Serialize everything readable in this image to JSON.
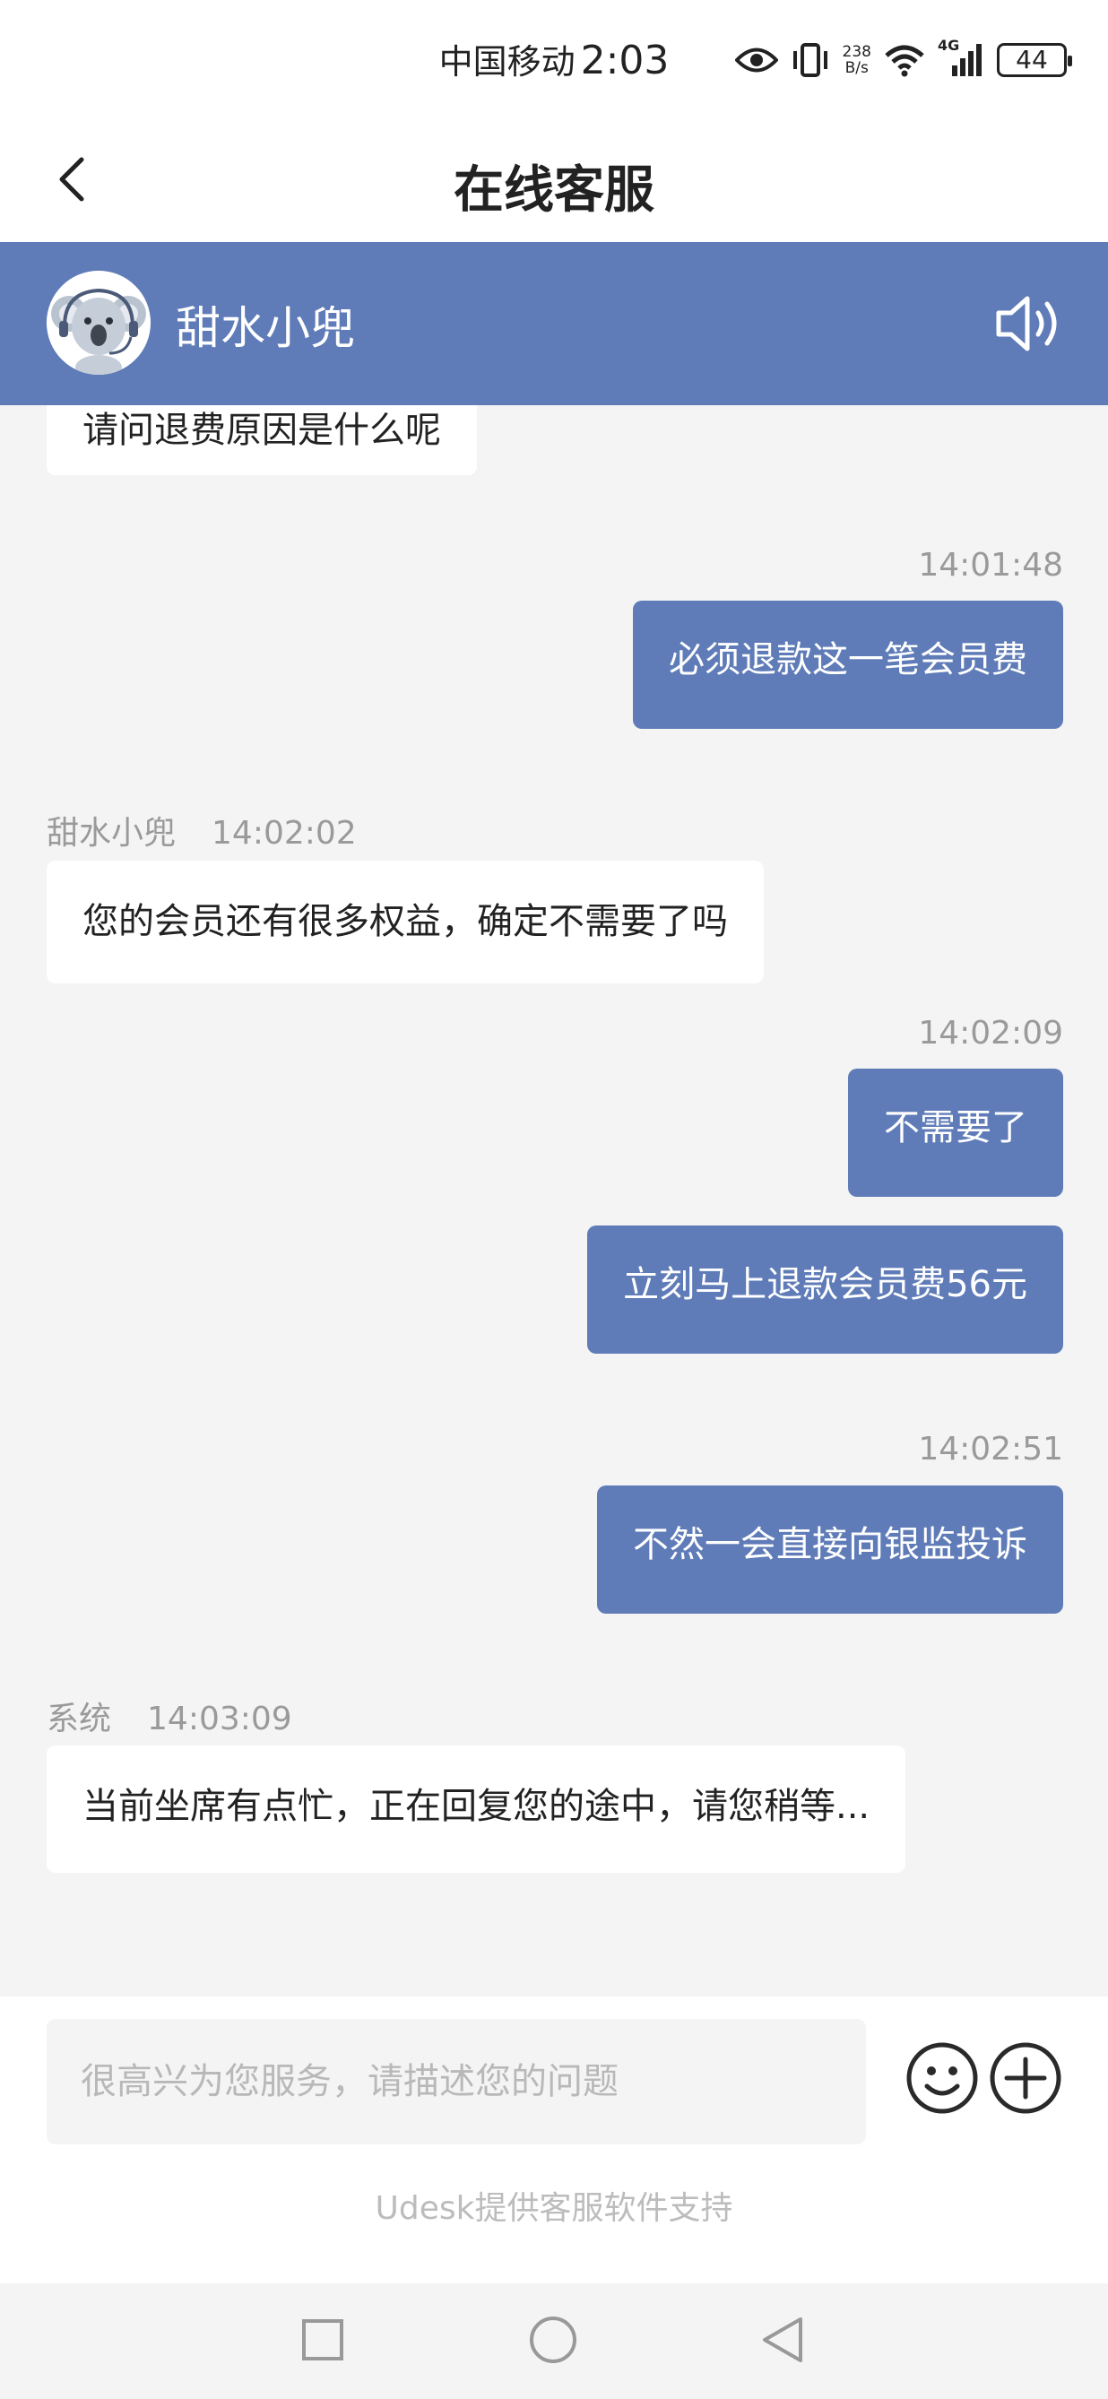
{
  "status_bar": {
    "carrier": "中国移动",
    "time": "2:03",
    "net_speed_value": "238",
    "net_speed_unit": "B/s",
    "network_type": "4G",
    "battery": "44"
  },
  "header": {
    "title": "在线客服"
  },
  "agent": {
    "name": "甜水小兜"
  },
  "messages": [
    {
      "side": "agent",
      "text": "请问退费原因是什么呢"
    },
    {
      "side": "user",
      "time": "14:01:48",
      "text": "必须退款这一笔会员费"
    },
    {
      "side": "agent",
      "sender": "甜水小兜",
      "time": "14:02:02",
      "text": "您的会员还有很多权益，确定不需要了吗"
    },
    {
      "side": "user",
      "time": "14:02:09",
      "text": "不需要了"
    },
    {
      "side": "user",
      "text": "立刻马上退款会员费56元"
    },
    {
      "side": "user",
      "time": "14:02:51",
      "text": "不然一会直接向银监投诉"
    },
    {
      "side": "system",
      "sender": "系统",
      "time": "14:03:09",
      "text": "当前坐席有点忙，正在回复您的途中，请您稍等..."
    }
  ],
  "input": {
    "placeholder": "很高兴为您服务，请描述您的问题",
    "value": ""
  },
  "footer": {
    "powered_by": "Udesk提供客服软件支持"
  },
  "colors": {
    "accent": "#5f7cb8",
    "background": "#f4f4f4",
    "bubble_in": "#ffffff",
    "timestamp": "#9a9a9a"
  },
  "icons": {
    "back": "chevron-left-icon",
    "speaker": "speaker-icon",
    "emoji": "smiley-icon",
    "add": "plus-circle-icon",
    "recent": "square-icon",
    "home": "circle-icon",
    "nav_back": "triangle-left-icon"
  }
}
